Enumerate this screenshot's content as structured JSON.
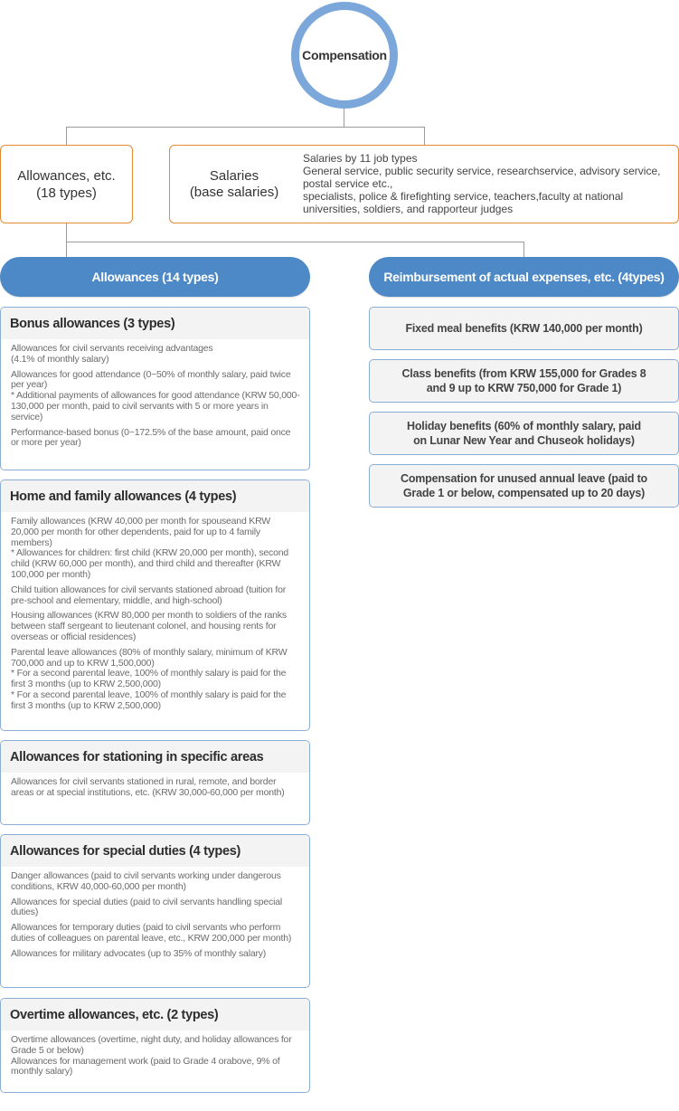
{
  "root": {
    "label": "Compensation"
  },
  "colors": {
    "circle_ring": "#7ba7da",
    "top_box_border": "#e58a33",
    "pill_fill": "#4d89c6",
    "card_border": "#8aaed6",
    "card_header_fill": "#f3f3f3",
    "connector": "#9a9a9a"
  },
  "allowances_etc": {
    "line1": "Allowances, etc.",
    "line2": "(18 types)"
  },
  "salaries": {
    "title_line1": "Salaries",
    "title_line2": "(base salaries)",
    "desc": [
      "Salaries by 11 job types",
      "General service, public security service, researchservice, advisory service,",
      "postal service etc.,",
      "specialists, police & firefighting service, teachers,faculty at national",
      "universities, soldiers, and rapporteur judges"
    ]
  },
  "allowances_pill": {
    "label": "Allowances (14 types)"
  },
  "reimbursement_pill": {
    "label": "Reimbursement of actual expenses, etc. (4types)"
  },
  "allowance_cards": [
    {
      "title": "Bonus allowances (3 types)",
      "items": [
        [
          "Allowances for civil servants receiving advantages",
          "(4.1% of monthly salary)"
        ],
        [
          "Allowances for good attendance (0~50% of monthly salary, paid twice per year)",
          "* Additional payments of allowances for good attendance (KRW 50,000-130,000 per month, paid to civil servants with 5 or more years in service)"
        ],
        [
          "Performance-based bonus (0~172.5% of the base amount, paid once or more per year)"
        ]
      ]
    },
    {
      "title": "Home and family allowances (4 types)",
      "items": [
        [
          "Family allowances (KRW 40,000 per month for spouseand KRW 20,000 per month for other dependents, paid for up to 4 family members)",
          "* Allowances for children: first child (KRW 20,000 per month), second child (KRW 60,000 per month), and third child and thereafter (KRW 100,000 per month)"
        ],
        [
          "Child tuition allowances for civil servants stationed abroad (tuition for pre-school and elementary, middle, and high-school)"
        ],
        [
          "Housing allowances (KRW 80,000 per month to soldiers of the ranks between staff sergeant to lieutenant colonel, and housing rents for overseas or official residences)"
        ],
        [
          "Parental leave allowances (80% of monthly salary, minimum of KRW 700,000 and up to KRW 1,500,000)",
          "* For a second parental leave, 100% of monthly salary is paid for the first 3 months (up to KRW 2,500,000)",
          "* For a second parental leave, 100% of monthly salary is paid for the first 3 months (up to KRW 2,500,000)"
        ]
      ]
    },
    {
      "title": "Allowances for stationing in specific areas",
      "items": [
        [
          "Allowances for civil servants stationed in rural, remote, and border areas or at special institutions, etc. (KRW 30,000-60,000 per month)"
        ]
      ]
    },
    {
      "title": "Allowances for special duties (4 types)",
      "items": [
        [
          "Danger allowances (paid to civil servants working under dangerous conditions, KRW 40,000-60,000 per month)"
        ],
        [
          "Allowances for special duties (paid to civil servants handling special duties)"
        ],
        [
          "Allowances for temporary duties (paid to civil servants who perform duties of colleagues on parental leave, etc., KRW 200,000 per month)"
        ],
        [
          "Allowances for military advocates (up to 35% of monthly salary)"
        ]
      ]
    },
    {
      "title": "Overtime allowances, etc. (2 types)",
      "items": [
        [
          "Overtime allowances (overtime, night duty, and holiday allowances for Grade 5 or below)",
          "Allowances for management work (paid to Grade 4 orabove, 9% of monthly salary)"
        ]
      ]
    }
  ],
  "reimbursement_cards": [
    {
      "lines": [
        "Fixed meal benefits (KRW 140,000 per month)"
      ]
    },
    {
      "lines": [
        "Class benefits (from KRW 155,000 for Grades 8",
        "and 9 up to KRW 750,000 for Grade 1)"
      ]
    },
    {
      "lines": [
        "Holiday benefits (60% of monthly salary, paid",
        "on Lunar New Year and Chuseok holidays)"
      ]
    },
    {
      "lines": [
        "Compensation for unused annual leave (paid to",
        "Grade 1 or below, compensated up to 20 days)"
      ]
    }
  ]
}
